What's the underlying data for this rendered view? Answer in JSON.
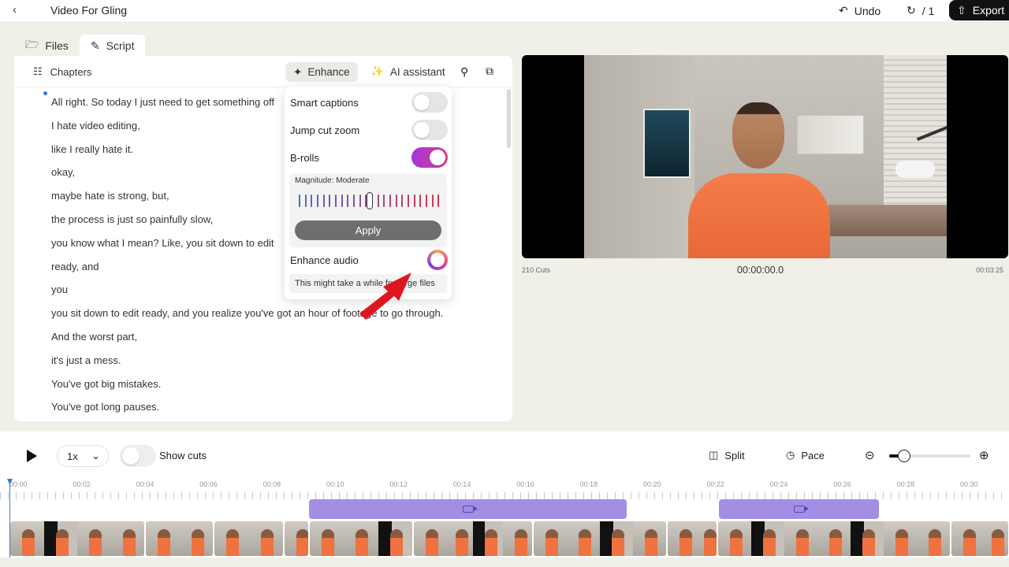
{
  "header": {
    "title": "Video For Gling",
    "undo_label": "Undo",
    "redo_label": "/ 1",
    "export_label": "Export"
  },
  "tabs": [
    {
      "label": "Files"
    },
    {
      "label": "Script"
    }
  ],
  "script_toolbar": {
    "chapters_label": "Chapters",
    "enhance_label": "Enhance",
    "ai_label": "AI assistant"
  },
  "transcript": [
    "All right. So today I just need to get something off",
    "I hate video editing,",
    "like I really hate it.",
    "okay,",
    "maybe hate is strong, but,",
    "the process is just so painfully slow,",
    "you know what I mean? Like, you sit down to edit",
    "ready, and",
    "you",
    "you sit down to edit ready, and you realize you've got an hour of footage to go through.",
    "And the worst part,",
    "it's just a mess.",
    "You've got big mistakes.",
    "You've got long pauses."
  ],
  "enhance_popup": {
    "smart_captions": {
      "label": "Smart captions",
      "on": false
    },
    "jump_cut_zoom": {
      "label": "Jump cut zoom",
      "on": false
    },
    "b_rolls": {
      "label": "B-rolls",
      "on": true
    },
    "magnitude_label": "Magnitude: Moderate",
    "magnitude_level": 0.5,
    "apply_label": "Apply",
    "enhance_audio_label": "Enhance audio",
    "note": "This might take a while for large files"
  },
  "video": {
    "cuts_label": "210 Cuts",
    "timecode": "00:00:00.0",
    "duration": "00:03:25"
  },
  "timeline_controls": {
    "speed": "1x",
    "show_cuts_label": "Show cuts",
    "show_cuts_on": false,
    "split_label": "Split",
    "pace_label": "Pace",
    "zoom_level": 0.15
  },
  "ruler": [
    "00:00",
    "00:02",
    "00:04",
    "00:06",
    "00:08",
    "00:10",
    "00:12",
    "00:14",
    "00:16",
    "00:18",
    "00:20",
    "00:22",
    "00:24",
    "00:26",
    "00:28",
    "00:30"
  ],
  "colors": {
    "accent_blue": "#3a7bd5",
    "broll_purple": "#a48ee4",
    "toggle_gradient_start": "#a235e0",
    "toggle_gradient_end": "#e33a8a",
    "arrow_red": "#e0161e"
  }
}
